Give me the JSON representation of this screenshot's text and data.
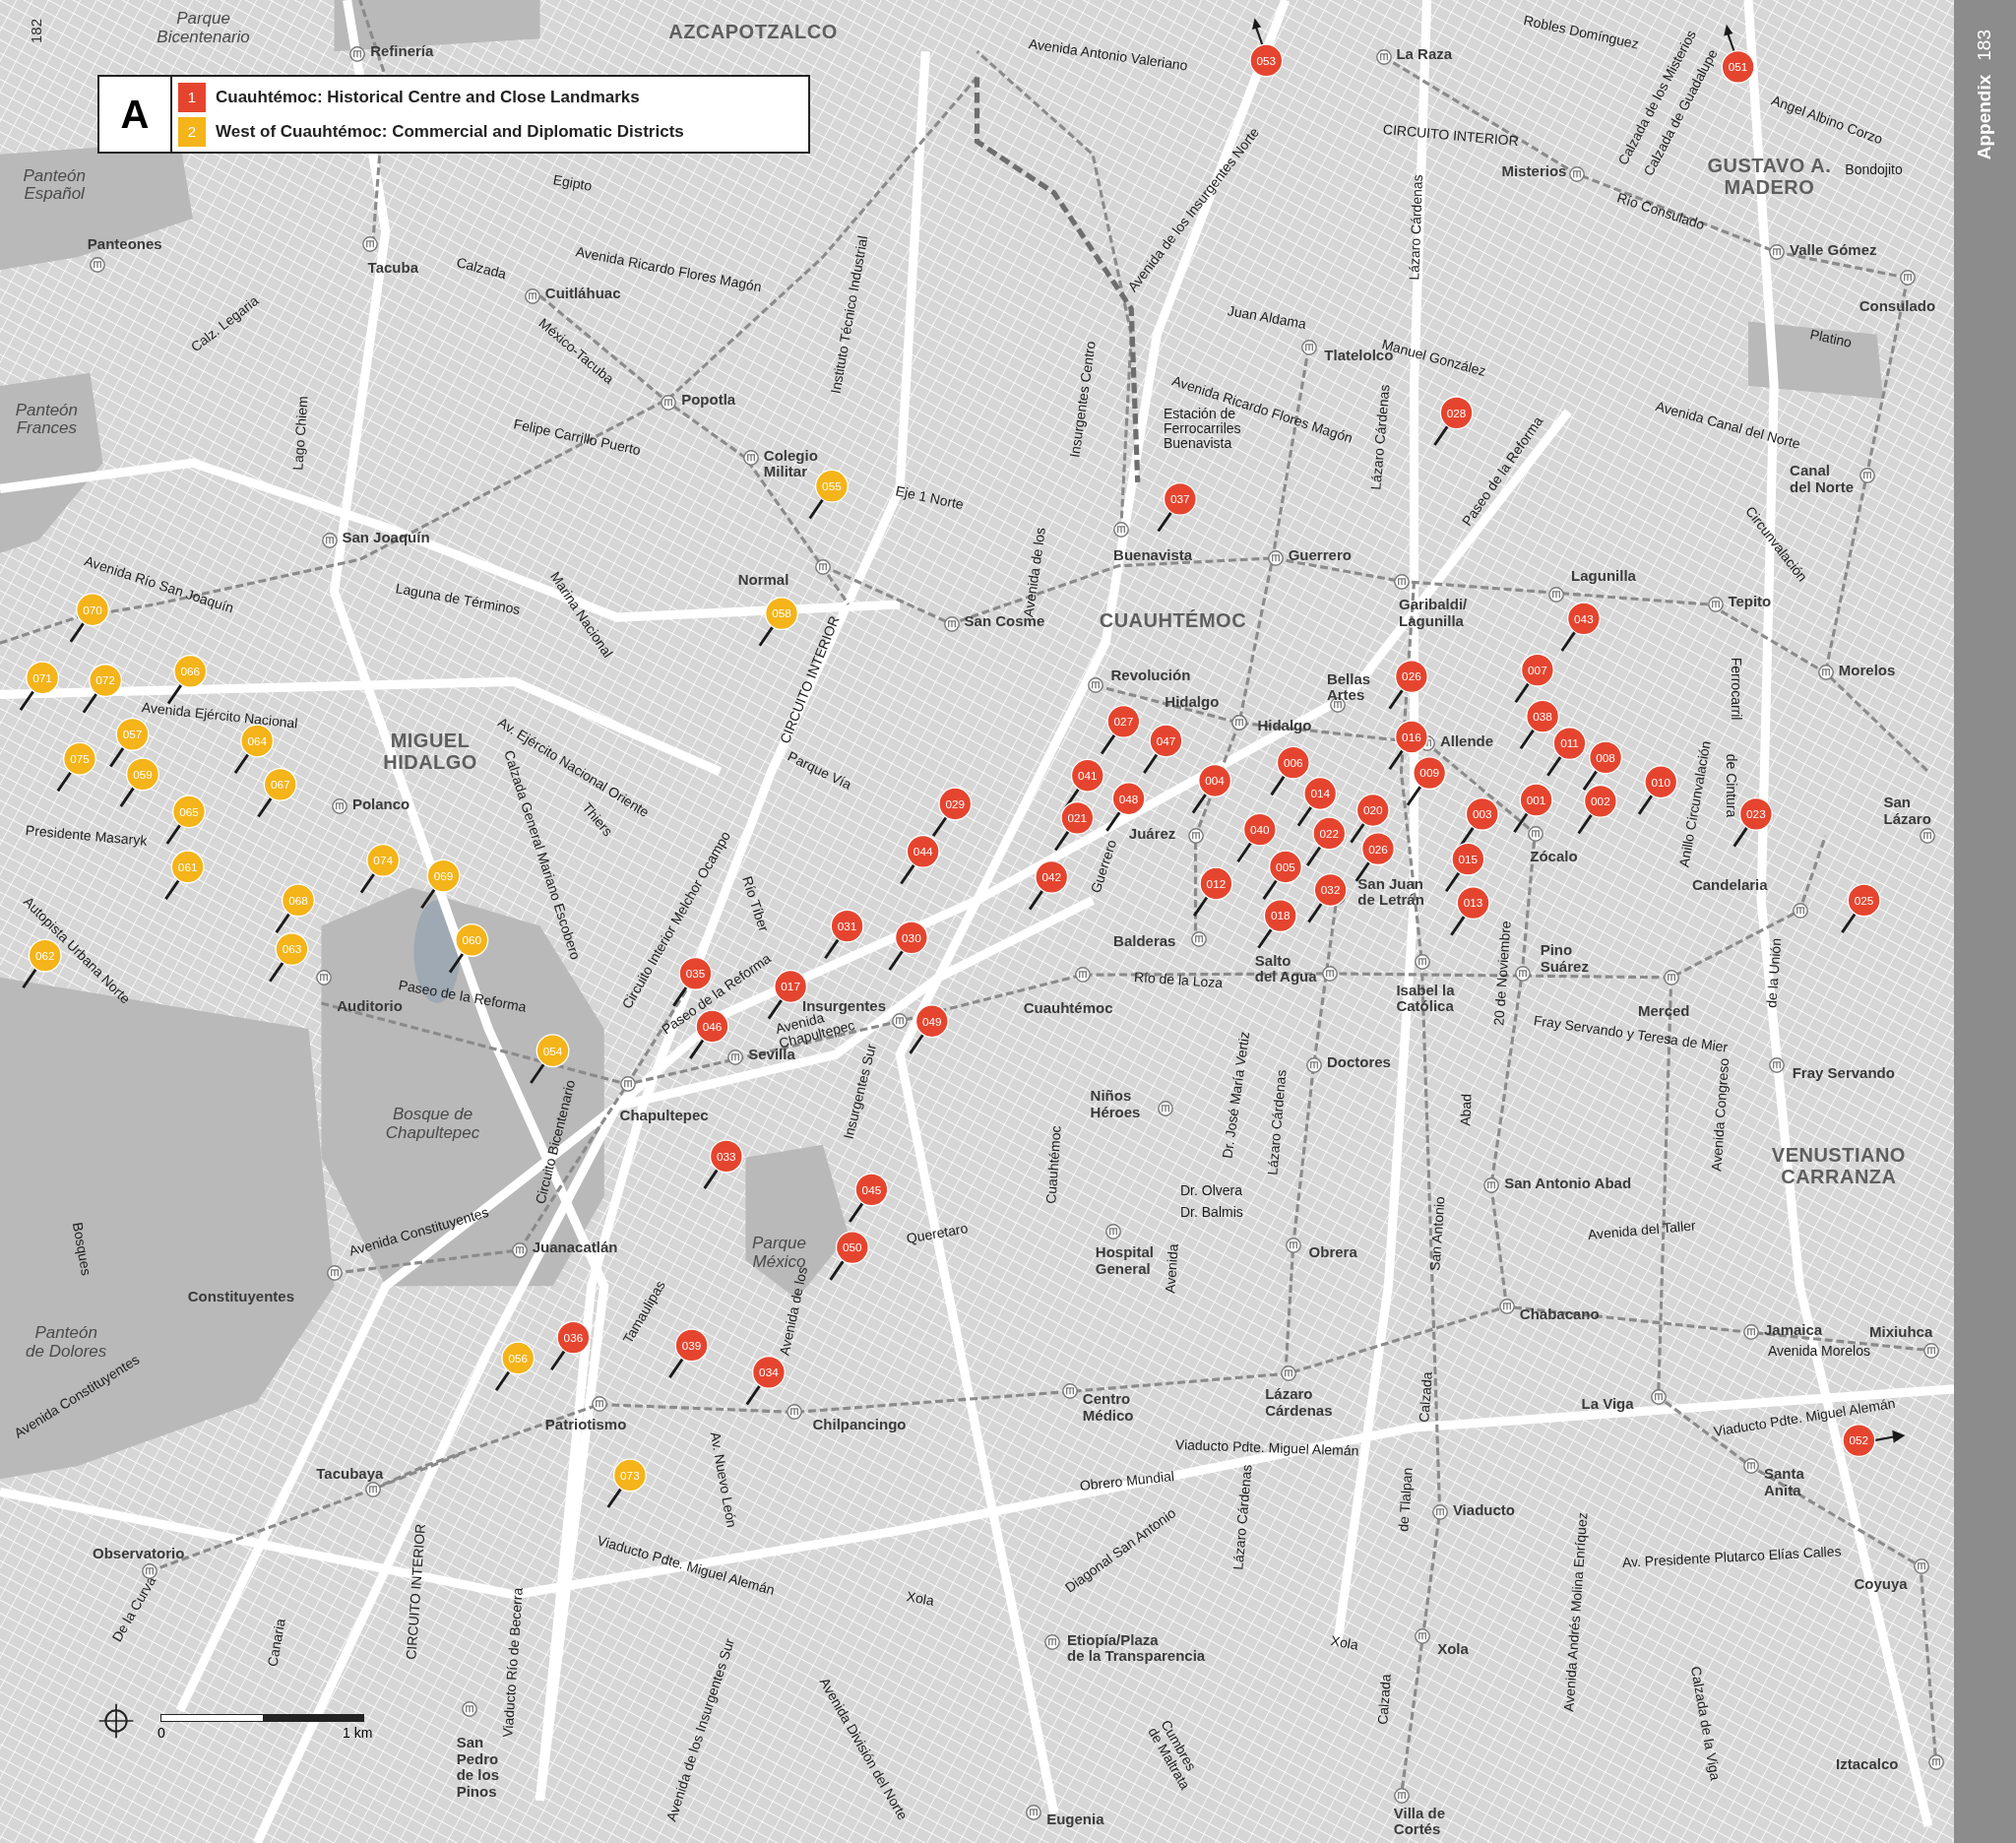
{
  "page_number": "182",
  "sidebar": {
    "section": "Appendix",
    "page_number": "183"
  },
  "legend": {
    "letter": "A",
    "entries": [
      {
        "number": "1",
        "text": "Cuauhtémoc: Historical Centre and Close Landmarks",
        "color": "#e5452f"
      },
      {
        "number": "2",
        "text": "West of Cuauhtémoc: Commercial and Diplomatic Districts",
        "color": "#f4b41a"
      }
    ]
  },
  "districts": [
    "AZCAPOTZALCO",
    "MIGUEL\nHIDALGO",
    "CUAUHTÉMOC",
    "GUSTAVO A.\nMADERO",
    "VENUSTIANO\nCARRANZA"
  ],
  "parks": [
    "Parque\nBicentenario",
    "Panteón\nEspañol",
    "Panteón\nFrances",
    "Bosque de\nChapultepec",
    "Parque\nMéxico",
    "Panteón\nde Dolores"
  ],
  "stations": [
    "Refinería",
    "La Raza",
    "Misterios",
    "Panteones",
    "Tacuba",
    "Cuitláhuac",
    "Tlatelolco",
    "Popotla",
    "Colegio\nMilitar",
    "Valle Gómez",
    "Consulado",
    "Normal",
    "Buenavista",
    "Guerrero",
    "Lagunilla",
    "Garibaldi/\nLagunilla",
    "Tepito",
    "San Joaquín",
    "San Cosme",
    "Revolución",
    "Hidalgo",
    "Hidalgo",
    "Bellas\nArtes",
    "Allende",
    "Morelos",
    "Canal\ndel Norte",
    "Polanco",
    "Zócalo",
    "San\nLázaro",
    "Juárez",
    "Candelaria",
    "Balderas",
    "San Juan\nde Letrán",
    "Salto\ndel Agua",
    "Pino\nSuárez",
    "Auditorio",
    "Insurgentes",
    "Cuauhtémoc",
    "Isabel la\nCatólica",
    "Merced",
    "Sevilla",
    "Chapultepec",
    "Doctores",
    "Fray Servando",
    "Niños\nHéroes",
    "San Antonio Abad",
    "Juanacatlán",
    "Hospital\nGeneral",
    "Obrera",
    "Constituyentes",
    "Chabacano",
    "Jamaica",
    "Mixiuhca",
    "Centro\nMédico",
    "Lázaro\nCárdenas",
    "La Viga",
    "Patriotismo",
    "Chilpancingo",
    "Tacubaya",
    "Santa\nAnita",
    "Observatorio",
    "Viaducto",
    "Coyuya",
    "Etiopía/Plaza\nde la Transparencia",
    "Xola",
    "San\nPedro\nde los\nPinos",
    "Eugenia",
    "Villa de\nCortés",
    "Iztacalco"
  ],
  "streets": [
    "Avenida Antonio Valeriano",
    "Robles Domínguez",
    "Calzada de los Misterios",
    "Calzada de Guadalupe",
    "Angel Albino Corzo",
    "Bondojito",
    "CIRCUITO INTERIOR",
    "Río Consulado",
    "Egipto",
    "Avenida Ricardo Flores Magón",
    "Calzada",
    "México-Tacuba",
    "Calz. Legaria",
    "Avenida de los Insurgentes Norte",
    "Juan Aldama",
    "Lázaro Cárdenas",
    "Manuel González",
    "Platino",
    "Avenida Ricardo Flores Magón",
    "Instituto Técnico Industrial",
    "Felipe Carrillo Puerto",
    "Lago Chiem",
    "Eje 1 Norte",
    "Insurgentes Centro",
    "Estación de\nFerrocarriles\nBuenavista",
    "Lázaro Cárdenas",
    "Paseo de la Reforma",
    "Avenida Canal del Norte",
    "Circunvalación",
    "Avenida Río San Joaquín",
    "Laguna de Términos",
    "Marina Nacional",
    "Avenida de los",
    "CIRCUITO INTERIOR",
    "Ferrocarril",
    "de Cintura",
    "Avenida Ejército Nacional",
    "Av. Ejército Nacional Oriente",
    "Calzada General Mariano Escobero",
    "Thiers",
    "Circuito Interior Melchor Ocampo",
    "Parque Vía",
    "Río Tíber",
    "Anillo Circunvalación",
    "Presidente Masaryk",
    "Autopista Urbana Norte",
    "Guerrero",
    "Paseo de la Reforma",
    "Paseo de la Reforma",
    "Avenida\nChapultepec",
    "Río de la Loza",
    "Dr. José María Vertiz",
    "20 de Noviembre",
    "Fray Servando y Teresa de Mier",
    "de la Unión",
    "Circuito Bicentenario",
    "Insurgentes Sur",
    "Avenida Constituyentes",
    "Cuauhtémoc",
    "Dr. Olvera",
    "Dr. Balmis",
    "Lázaro Cárdenas",
    "Avenida Congreso",
    "Abad",
    "San Antonio",
    "Avenida del Taller",
    "Bosques",
    "Queretaro",
    "Tamaulipas",
    "Avenida de los",
    "Avenida",
    "Avenida Morelos",
    "Avenida Constituyentes",
    "Av. Nuevo León",
    "Calzada",
    "Viaducto Pdte. Miguel Alemán",
    "Viaducto Pdte. Miguel Alemán",
    "Obrero Mundial",
    "Viaducto Pdte. Miguel Alemán",
    "de Tlalpan",
    "Diagonal San Antonio",
    "Lázaro Cárdenas",
    "Av. Presidente Plutarco Elías Calles",
    "Avenida Andrés Molina Enríquez",
    "Calzada de la Viga",
    "Xola",
    "Xola",
    "De la Curva",
    "Canaria",
    "CIRCUITO INTERIOR",
    "Viaducto Río de Becerra",
    "Avenida de los Insurgentes Sur",
    "Avenida División del Norte",
    "Cumbres\nde Maltrata",
    "Calzada"
  ],
  "pins": [
    {
      "number": "053",
      "color": "#e5452f",
      "kind": "north"
    },
    {
      "number": "051",
      "color": "#e5452f",
      "kind": "north"
    },
    {
      "number": "028",
      "color": "#e5452f",
      "kind": "pin"
    },
    {
      "number": "037",
      "color": "#e5452f",
      "kind": "pin"
    },
    {
      "number": "043",
      "color": "#e5452f",
      "kind": "pin"
    },
    {
      "number": "026",
      "color": "#e5452f",
      "kind": "pin"
    },
    {
      "number": "007",
      "color": "#e5452f",
      "kind": "pin"
    },
    {
      "number": "038",
      "color": "#e5452f",
      "kind": "pin"
    },
    {
      "number": "027",
      "color": "#e5452f",
      "kind": "pin"
    },
    {
      "number": "047",
      "color": "#e5452f",
      "kind": "pin"
    },
    {
      "number": "016",
      "color": "#e5452f",
      "kind": "pin"
    },
    {
      "number": "011",
      "color": "#e5452f",
      "kind": "pin"
    },
    {
      "number": "008",
      "color": "#e5452f",
      "kind": "pin"
    },
    {
      "number": "041",
      "color": "#e5452f",
      "kind": "pin"
    },
    {
      "number": "006",
      "color": "#e5452f",
      "kind": "pin"
    },
    {
      "number": "004",
      "color": "#e5452f",
      "kind": "pin"
    },
    {
      "number": "009",
      "color": "#e5452f",
      "kind": "pin"
    },
    {
      "number": "014",
      "color": "#e5452f",
      "kind": "pin"
    },
    {
      "number": "010",
      "color": "#e5452f",
      "kind": "pin"
    },
    {
      "number": "029",
      "color": "#e5452f",
      "kind": "pin"
    },
    {
      "number": "020",
      "color": "#e5452f",
      "kind": "pin"
    },
    {
      "number": "003",
      "color": "#e5452f",
      "kind": "pin"
    },
    {
      "number": "001",
      "color": "#e5452f",
      "kind": "pin"
    },
    {
      "number": "002",
      "color": "#e5452f",
      "kind": "pin"
    },
    {
      "number": "023",
      "color": "#e5452f",
      "kind": "pin"
    },
    {
      "number": "021",
      "color": "#e5452f",
      "kind": "pin"
    },
    {
      "number": "048",
      "color": "#e5452f",
      "kind": "pin"
    },
    {
      "number": "040",
      "color": "#e5452f",
      "kind": "pin"
    },
    {
      "number": "022",
      "color": "#e5452f",
      "kind": "pin"
    },
    {
      "number": "026",
      "color": "#e5452f",
      "kind": "pin"
    },
    {
      "number": "044",
      "color": "#e5452f",
      "kind": "pin"
    },
    {
      "number": "015",
      "color": "#e5452f",
      "kind": "pin"
    },
    {
      "number": "005",
      "color": "#e5452f",
      "kind": "pin"
    },
    {
      "number": "042",
      "color": "#e5452f",
      "kind": "pin"
    },
    {
      "number": "012",
      "color": "#e5452f",
      "kind": "pin"
    },
    {
      "number": "032",
      "color": "#e5452f",
      "kind": "pin"
    },
    {
      "number": "013",
      "color": "#e5452f",
      "kind": "pin"
    },
    {
      "number": "018",
      "color": "#e5452f",
      "kind": "pin"
    },
    {
      "number": "025",
      "color": "#e5452f",
      "kind": "pin"
    },
    {
      "number": "031",
      "color": "#e5452f",
      "kind": "pin"
    },
    {
      "number": "030",
      "color": "#e5452f",
      "kind": "pin"
    },
    {
      "number": "035",
      "color": "#e5452f",
      "kind": "pin"
    },
    {
      "number": "017",
      "color": "#e5452f",
      "kind": "pin"
    },
    {
      "number": "049",
      "color": "#e5452f",
      "kind": "pin"
    },
    {
      "number": "046",
      "color": "#e5452f",
      "kind": "pin"
    },
    {
      "number": "033",
      "color": "#e5452f",
      "kind": "pin"
    },
    {
      "number": "045",
      "color": "#e5452f",
      "kind": "pin"
    },
    {
      "number": "050",
      "color": "#e5452f",
      "kind": "pin"
    },
    {
      "number": "036",
      "color": "#e5452f",
      "kind": "pin"
    },
    {
      "number": "039",
      "color": "#e5452f",
      "kind": "pin"
    },
    {
      "number": "034",
      "color": "#e5452f",
      "kind": "pin"
    },
    {
      "number": "052",
      "color": "#e5452f",
      "kind": "east"
    },
    {
      "number": "055",
      "color": "#f4b41a",
      "kind": "pin"
    },
    {
      "number": "058",
      "color": "#f4b41a",
      "kind": "pin"
    },
    {
      "number": "070",
      "color": "#f4b41a",
      "kind": "pin"
    },
    {
      "number": "071",
      "color": "#f4b41a",
      "kind": "pin"
    },
    {
      "number": "072",
      "color": "#f4b41a",
      "kind": "pin"
    },
    {
      "number": "066",
      "color": "#f4b41a",
      "kind": "pin"
    },
    {
      "number": "057",
      "color": "#f4b41a",
      "kind": "pin"
    },
    {
      "number": "064",
      "color": "#f4b41a",
      "kind": "pin"
    },
    {
      "number": "075",
      "color": "#f4b41a",
      "kind": "pin"
    },
    {
      "number": "059",
      "color": "#f4b41a",
      "kind": "pin"
    },
    {
      "number": "067",
      "color": "#f4b41a",
      "kind": "pin"
    },
    {
      "number": "065",
      "color": "#f4b41a",
      "kind": "pin"
    },
    {
      "number": "061",
      "color": "#f4b41a",
      "kind": "pin"
    },
    {
      "number": "074",
      "color": "#f4b41a",
      "kind": "pin"
    },
    {
      "number": "069",
      "color": "#f4b41a",
      "kind": "pin"
    },
    {
      "number": "068",
      "color": "#f4b41a",
      "kind": "pin"
    },
    {
      "number": "063",
      "color": "#f4b41a",
      "kind": "pin"
    },
    {
      "number": "062",
      "color": "#f4b41a",
      "kind": "pin"
    },
    {
      "number": "060",
      "color": "#f4b41a",
      "kind": "pin"
    },
    {
      "number": "054",
      "color": "#f4b41a",
      "kind": "pin"
    },
    {
      "number": "056",
      "color": "#f4b41a",
      "kind": "pin"
    },
    {
      "number": "073",
      "color": "#f4b41a",
      "kind": "pin"
    }
  ],
  "scale_bar": {
    "start": "0",
    "end": "1 km"
  }
}
